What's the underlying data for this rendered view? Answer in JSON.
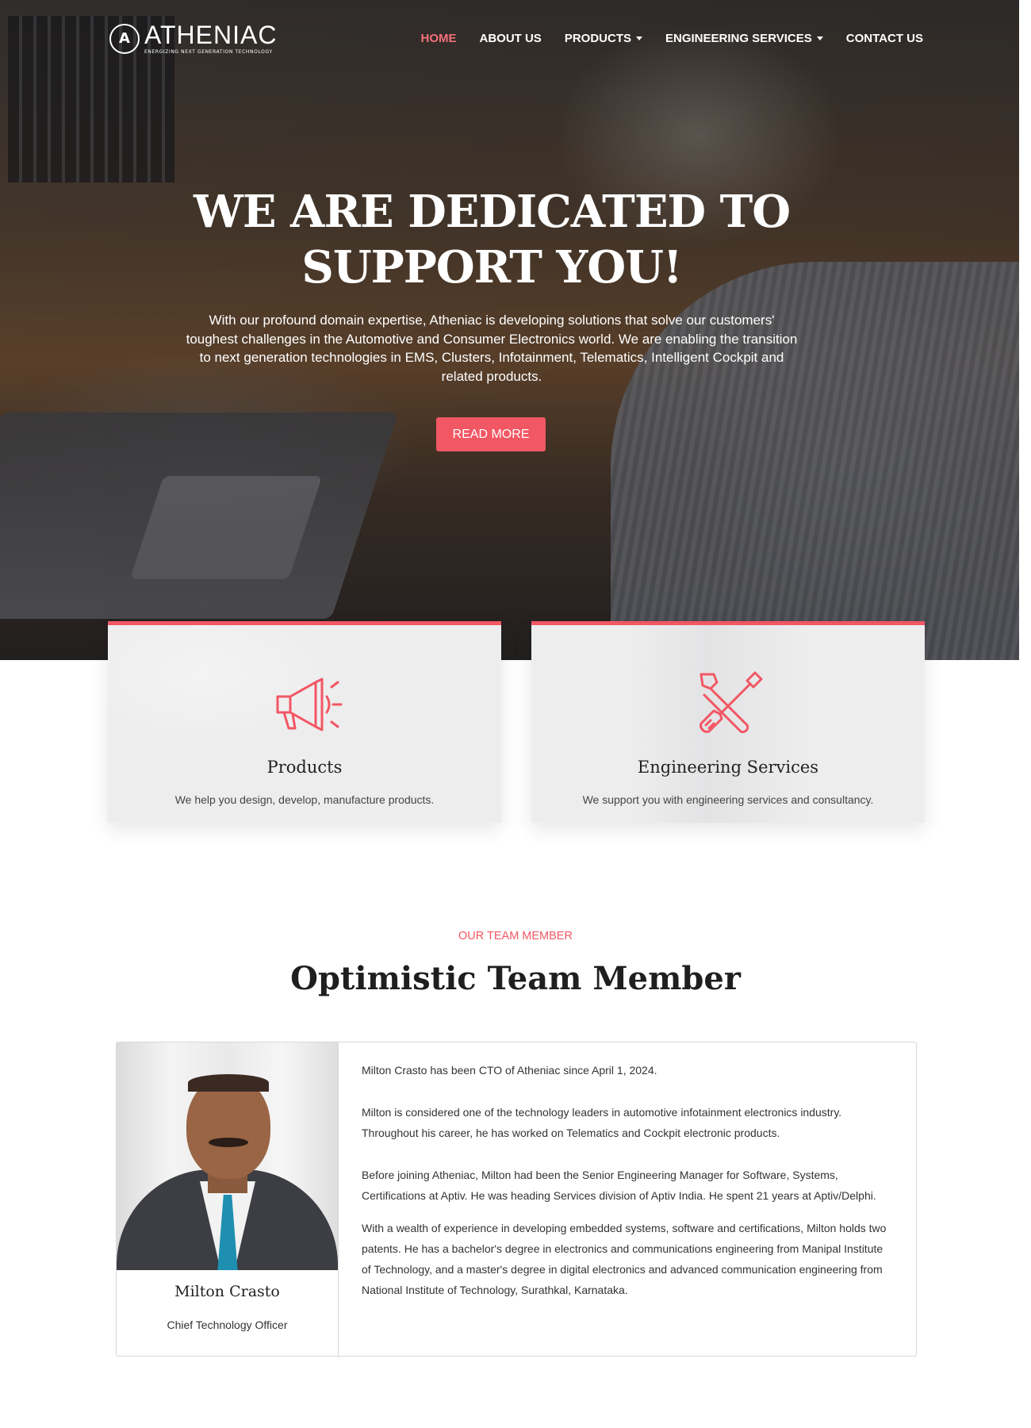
{
  "brand": {
    "name": "ATHENIAC",
    "tagline": "ENERGIZING NEXT GENERATION TECHNOLOGY",
    "mark": "A"
  },
  "nav": {
    "items": [
      {
        "label": "HOME",
        "active": true
      },
      {
        "label": "ABOUT US"
      },
      {
        "label": "PRODUCTS",
        "dropdown": true
      },
      {
        "label": "ENGINEERING SERVICES",
        "dropdown": true
      },
      {
        "label": "CONTACT US"
      }
    ]
  },
  "hero": {
    "title_line1": "WE ARE DEDICATED TO",
    "title_line2": "SUPPORT YOU!",
    "text": "With our profound domain expertise, Atheniac is developing solutions that solve our customers' toughest challenges in the Automotive and Consumer Electronics world. We are enabling the transition to next generation technologies in EMS, Clusters, Infotainment, Telematics, Intelligent Cockpit and related products.",
    "cta": "READ MORE"
  },
  "services": [
    {
      "icon": "megaphone-icon",
      "title": "Products",
      "desc": "We help you design, develop, manufacture products."
    },
    {
      "icon": "tools-icon",
      "title": "Engineering Services",
      "desc": "We support you with engineering services and consultancy."
    }
  ],
  "team": {
    "kicker": "OUR TEAM MEMBER",
    "title": "Optimistic Team Member",
    "member": {
      "name": "Milton Crasto",
      "role": "Chief Technology Officer",
      "bio": [
        "Milton Crasto has been CTO of Atheniac since April 1, 2024.",
        "Milton is considered one of the technology leaders in automotive infotainment electronics industry. Throughout his career, he has worked on Telematics and Cockpit electronic products.",
        "Before joining Atheniac, Milton had been the Senior Engineering Manager for Software, Systems, Certifications at Aptiv. He was heading Services division of Aptiv India. He spent 21 years at Aptiv/Delphi.",
        "With a wealth of experience in developing embedded systems, software and certifications, Milton holds two patents. He has a bachelor's degree in electronics and communications engineering from Manipal Institute of Technology, and a master's degree in digital electronics and advanced communication engineering from National Institute of Technology, Surathkal, Karnataka."
      ]
    }
  },
  "colors": {
    "accent": "#f25764",
    "nav_active": "#f2707a",
    "card_bg": "#ededee"
  }
}
